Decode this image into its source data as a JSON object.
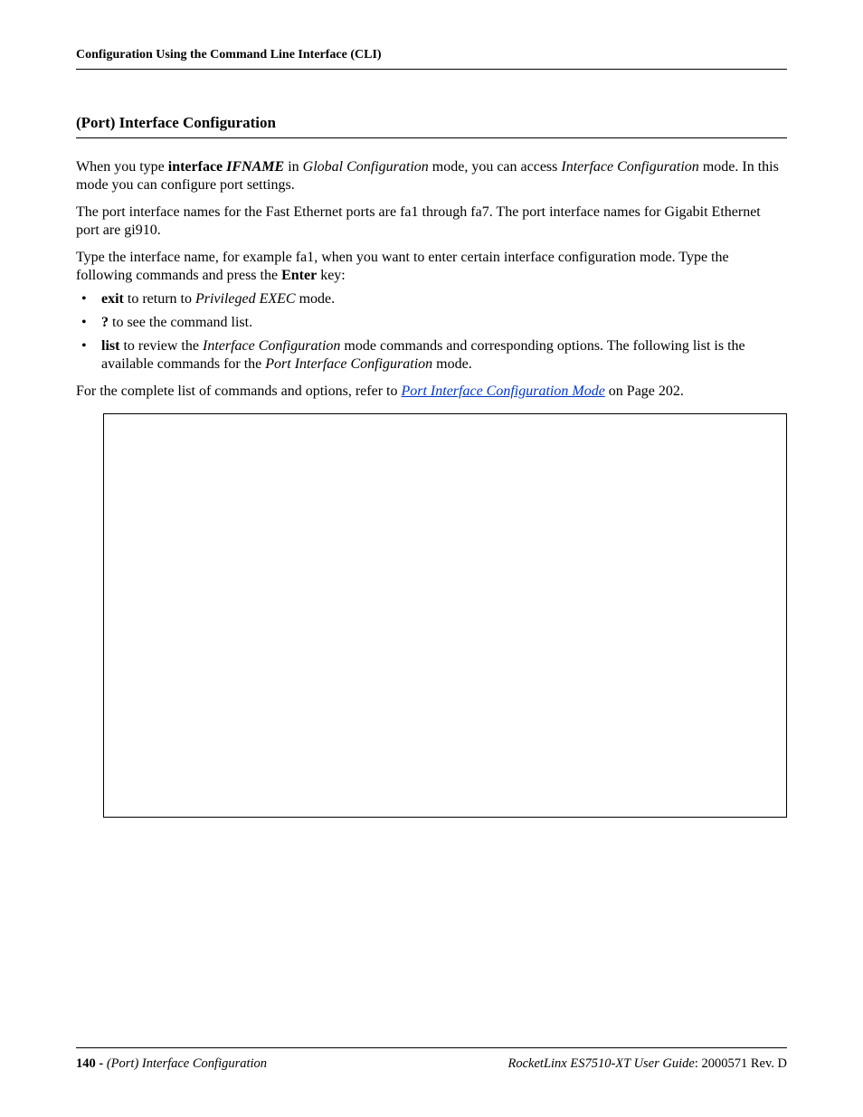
{
  "header": {
    "running": "Configuration Using the Command Line Interface (CLI)"
  },
  "section": {
    "title": "(Port) Interface Configuration"
  },
  "p1": {
    "a": "When you type ",
    "b": "interface",
    "c": " IFNAME",
    "d": " in ",
    "e": "Global Configuration",
    "f": " mode, you can access ",
    "g": "Interface Configuration",
    "h": " mode. In this mode you can configure port settings."
  },
  "p2": "The port interface names for the Fast Ethernet ports are fa1 through fa7. The port interface names for Gigabit Ethernet port are gi910.",
  "p3": {
    "a": "Type the interface name, for example fa1, when you want to enter certain interface configuration mode. Type the following commands and press the ",
    "b": "Enter",
    "c": " key:"
  },
  "bul": {
    "i1": {
      "a": "exit",
      "b": " to return to ",
      "c": "Privileged EXEC",
      "d": " mode."
    },
    "i2": {
      "a": "?",
      "b": " to see the command list."
    },
    "i3": {
      "a": "list",
      "b": " to review the ",
      "c": "Interface Configuration",
      "d": " mode commands and corresponding options. The following list is the available commands for the ",
      "e": "Port Interface Configuration",
      "f": " mode."
    }
  },
  "p4": {
    "a": "For the complete list of commands and options, refer to ",
    "link": "Port Interface Configuration Mode",
    "b": " on Page 202."
  },
  "footer": {
    "page": "140 - ",
    "section": "(Port) Interface Configuration",
    "product": "RocketLinx ES7510-XT  User Guide",
    "rev": ": 2000571 Rev. D"
  }
}
